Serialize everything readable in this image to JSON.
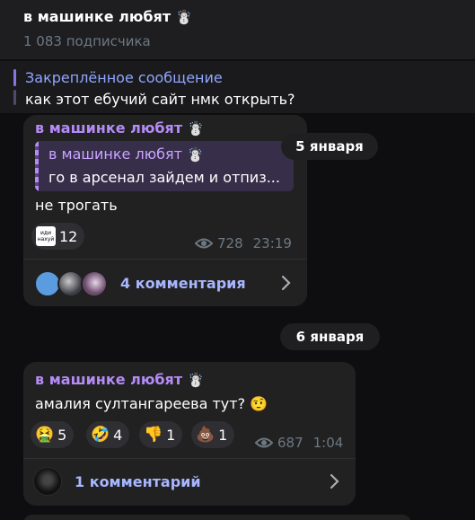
{
  "channel": {
    "title": "в машинке любят",
    "title_emoji": "☃️",
    "subscribers": "1 083 подписчика"
  },
  "pinned": {
    "label": "Закреплённое сообщение",
    "text": "как этот ебучий сайт нмк открыть?"
  },
  "dates": [
    "5 января",
    "6 января"
  ],
  "post1": {
    "author": "в машинке любят",
    "author_emoji": "☃️",
    "reply": {
      "author": "в машинке любят",
      "author_emoji": "☃️",
      "text": "го в арсенал зайдем и отпиз..."
    },
    "text": "не трогать",
    "reaction": {
      "sticker_line1": "иди",
      "sticker_line2": "нахуй",
      "count": "12"
    },
    "views": "728",
    "time": "23:19",
    "comments_label": "4 комментария"
  },
  "post2": {
    "author": "в машинке любят",
    "author_emoji": "☃️",
    "text": "амалия султангареева тут?",
    "text_emoji": "🤨",
    "reactions": [
      {
        "icon": "nauseated-face-icon",
        "emoji": "🤮",
        "count": "5"
      },
      {
        "icon": "rolling-laughing-icon",
        "emoji": "🤣",
        "count": "4"
      },
      {
        "icon": "thumbs-down-icon",
        "emoji": "👎",
        "count": "1"
      },
      {
        "icon": "pile-of-poo-icon",
        "emoji": "💩",
        "count": "1"
      }
    ],
    "views": "687",
    "time": "1:04",
    "comments_label": "1 комментарий"
  },
  "colors": {
    "accent_author": "#b58bf7",
    "comments_link": "#a7b6ff",
    "bubble": "#212121",
    "background": "#0e0e10"
  }
}
